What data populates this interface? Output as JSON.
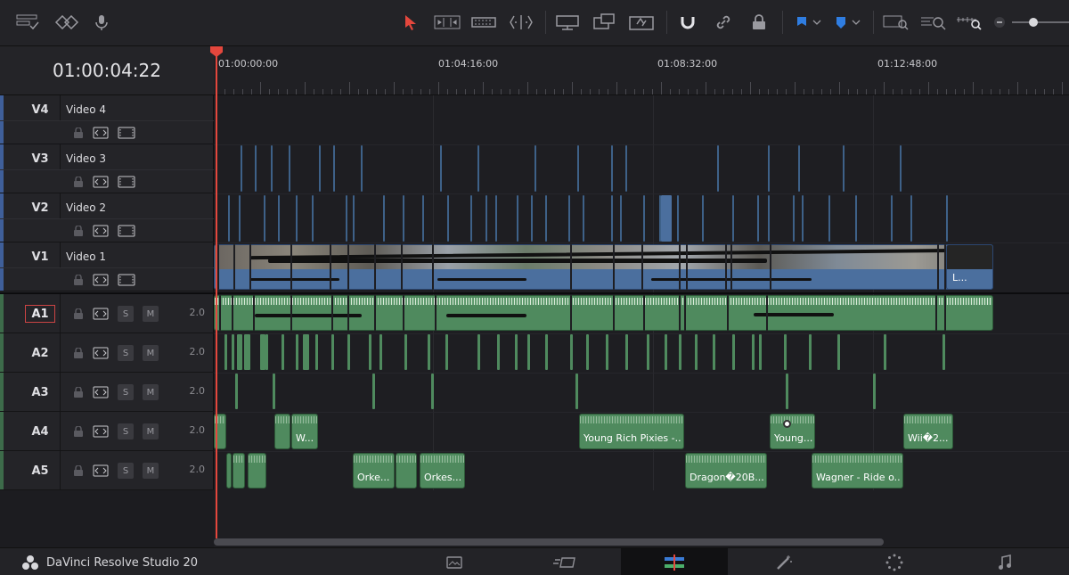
{
  "timecode": "01:00:04:22",
  "ruler": {
    "labels": [
      "01:00:00:00",
      "01:04:16:00",
      "01:08:32:00",
      "01:12:48:00"
    ]
  },
  "video_tracks": [
    {
      "id": "V4",
      "name": "Video 4"
    },
    {
      "id": "V3",
      "name": "Video 3"
    },
    {
      "id": "V2",
      "name": "Video 2"
    },
    {
      "id": "V1",
      "name": "Video 1"
    }
  ],
  "audio_tracks": [
    {
      "id": "A1",
      "solo": "S",
      "mute": "M",
      "channels": "2.0"
    },
    {
      "id": "A2",
      "solo": "S",
      "mute": "M",
      "channels": "2.0"
    },
    {
      "id": "A3",
      "solo": "S",
      "mute": "M",
      "channels": "2.0"
    },
    {
      "id": "A4",
      "solo": "S",
      "mute": "M",
      "channels": "2.0"
    },
    {
      "id": "A5",
      "solo": "S",
      "mute": "M",
      "channels": "2.0"
    }
  ],
  "clips": {
    "v1_end": "L...",
    "a4": [
      "W...",
      "Young Rich Pixies -...",
      "Young...",
      "Wii�2..."
    ],
    "a5": [
      "Orke...",
      "Orkes...",
      "Dragon�20B...",
      "Wagner - Ride o..."
    ]
  },
  "app": {
    "name": "DaVinci Resolve Studio 20"
  },
  "icons": {
    "toolbar": [
      "timeline-options-icon",
      "edit-mode-icon",
      "voiceover-icon",
      "selection-tool-icon",
      "trim-tool-icon",
      "dynamic-trim-icon",
      "blade-tool-icon",
      "insert-clip-icon",
      "overwrite-clip-icon",
      "replace-clip-icon",
      "snapping-icon",
      "linked-selection-icon",
      "position-lock-icon",
      "flag-icon",
      "marker-icon",
      "zoom-full-icon",
      "zoom-detail-icon",
      "zoom-custom-icon"
    ],
    "pages": [
      "media-page-icon",
      "cut-page-icon",
      "edit-page-icon",
      "fusion-page-icon",
      "color-page-icon",
      "fairlight-page-icon"
    ]
  },
  "colors": {
    "playhead": "#e4473d",
    "video_clip": "#4b6f9e",
    "audio_clip": "#4f8a5e",
    "selected_tool": "#e4473d",
    "flag": "#2f7de1"
  }
}
